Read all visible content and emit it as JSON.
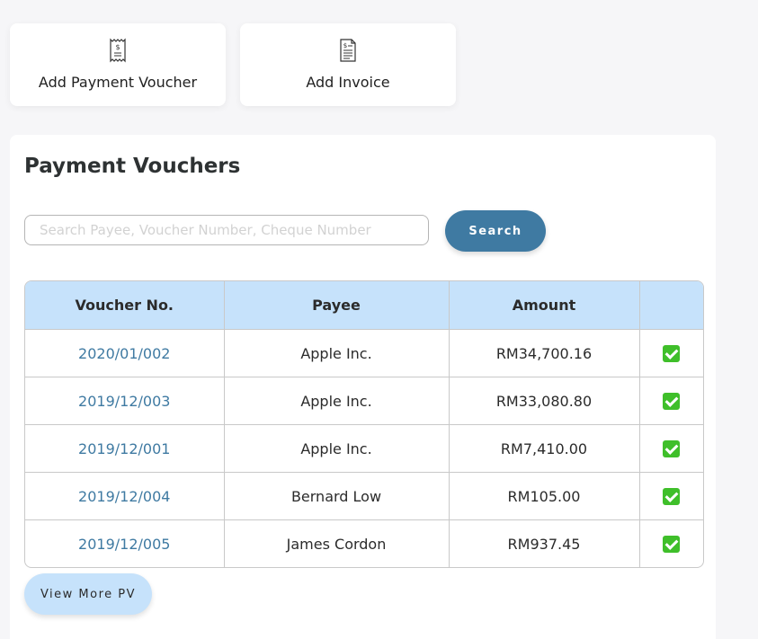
{
  "actions": {
    "add_payment_voucher": {
      "label": "Add Payment Voucher",
      "icon": "receipt-icon"
    },
    "add_invoice": {
      "label": "Add Invoice",
      "icon": "invoice-document-icon"
    }
  },
  "panel": {
    "title": "Payment Vouchers",
    "search": {
      "placeholder": "Search Payee, Voucher Number, Cheque Number",
      "value": "",
      "button_label": "Search"
    },
    "table": {
      "headers": [
        "Voucher No.",
        "Payee",
        "Amount",
        ""
      ],
      "rows": [
        {
          "voucher_no": "2020/01/002",
          "payee": "Apple Inc.",
          "amount": "RM34,700.16",
          "status_icon": "check-icon"
        },
        {
          "voucher_no": "2019/12/003",
          "payee": "Apple Inc.",
          "amount": "RM33,080.80",
          "status_icon": "check-icon"
        },
        {
          "voucher_no": "2019/12/001",
          "payee": "Apple Inc.",
          "amount": "RM7,410.00",
          "status_icon": "check-icon"
        },
        {
          "voucher_no": "2019/12/004",
          "payee": "Bernard Low",
          "amount": "RM105.00",
          "status_icon": "check-icon"
        },
        {
          "voucher_no": "2019/12/005",
          "payee": "James Cordon",
          "amount": "RM937.45",
          "status_icon": "check-icon"
        }
      ]
    },
    "view_more_label": "View More PV"
  },
  "colors": {
    "accent": "#3f7aa2",
    "header_bg": "#c6e2fb",
    "check_green": "#3fbf2a",
    "page_bg": "#f6f6f8"
  }
}
